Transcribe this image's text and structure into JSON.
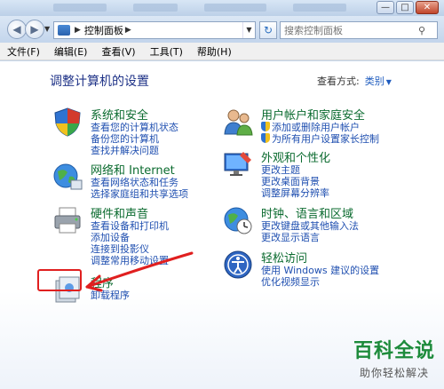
{
  "window": {
    "minimize": "—",
    "maximize": "□",
    "close": "✕"
  },
  "address": {
    "crumb": "控制面板",
    "search_placeholder": "搜索控制面板"
  },
  "menu": [
    "文件(F)",
    "编辑(E)",
    "查看(V)",
    "工具(T)",
    "帮助(H)"
  ],
  "main": {
    "title": "调整计算机的设置",
    "view_by_label": "查看方式:",
    "view_by_value": "类别"
  },
  "sections": {
    "security": {
      "title": "系统和安全",
      "links": [
        "查看您的计算机状态",
        "备份您的计算机",
        "查找并解决问题"
      ]
    },
    "network": {
      "title": "网络和 Internet",
      "links": [
        "查看网络状态和任务",
        "选择家庭组和共享选项"
      ]
    },
    "hardware": {
      "title": "硬件和声音",
      "links": [
        "查看设备和打印机",
        "添加设备",
        "连接到投影仪",
        "调整常用移动设置"
      ]
    },
    "programs": {
      "title": "程序",
      "links": [
        "卸载程序"
      ]
    },
    "users": {
      "title": "用户帐户和家庭安全",
      "links": [
        "添加或删除用户帐户",
        "为所有用户设置家长控制"
      ]
    },
    "appearance": {
      "title": "外观和个性化",
      "links": [
        "更改主题",
        "更改桌面背景",
        "调整屏幕分辨率"
      ]
    },
    "clock": {
      "title": "时钟、语言和区域",
      "links": [
        "更改键盘或其他输入法",
        "更改显示语言"
      ]
    },
    "ease": {
      "title": "轻松访问",
      "links": [
        "使用 Windows 建议的设置",
        "优化视频显示"
      ]
    }
  },
  "watermark": {
    "big": "百科全说",
    "small": "助你轻松解决"
  },
  "colors": {
    "accent_link": "#1f4fb0",
    "heading_green": "#0b6b2f",
    "annotation_red": "#e01f1f"
  }
}
